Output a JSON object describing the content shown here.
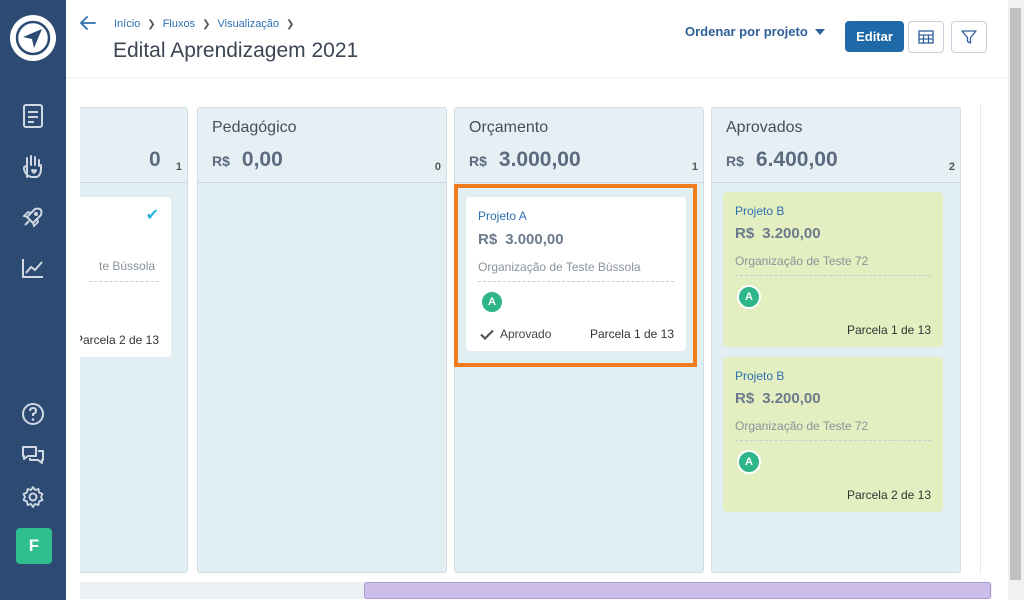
{
  "breadcrumb": [
    "Início",
    "Fluxos",
    "Visualização"
  ],
  "page_title": "Edital Aprendizagem 2021",
  "toolbar": {
    "sort_label": "Ordenar por projeto",
    "edit_label": "Editar"
  },
  "sidebar": {
    "user_initial": "F"
  },
  "columns": [
    {
      "title": "",
      "currency": "",
      "amount": "0",
      "count": "1"
    },
    {
      "title": "Pedagógico",
      "currency": "R$",
      "amount": "0,00",
      "count": "0"
    },
    {
      "title": "Orçamento",
      "currency": "R$",
      "amount": "3.000,00",
      "count": "1"
    },
    {
      "title": "Aprovados",
      "currency": "R$",
      "amount": "6.400,00",
      "count": "2"
    }
  ],
  "cards": [
    {
      "org": "te Bússola",
      "parcel": "Parcela 2 de 13"
    },
    {
      "project": "Projeto A",
      "currency": "R$",
      "amount": "3.000,00",
      "org": "Organização de Teste Bússola",
      "avatar": "A",
      "status": "Aprovado",
      "parcel": "Parcela 1 de 13"
    },
    {
      "project": "Projeto B",
      "currency": "R$",
      "amount": "3.200,00",
      "org": "Organização de Teste 72",
      "avatar": "A",
      "parcel": "Parcela 1 de 13"
    },
    {
      "project": "Projeto B",
      "currency": "R$",
      "amount": "3.200,00",
      "org": "Organização de Teste 72",
      "avatar": "A",
      "parcel": "Parcela 2 de 13"
    }
  ],
  "colors": {
    "sidebar": "#2d4a73",
    "primary": "#1f69a8",
    "highlight": "#f07c1e",
    "approved_card": "#e3efc0",
    "avatar": "#2fb58a"
  }
}
